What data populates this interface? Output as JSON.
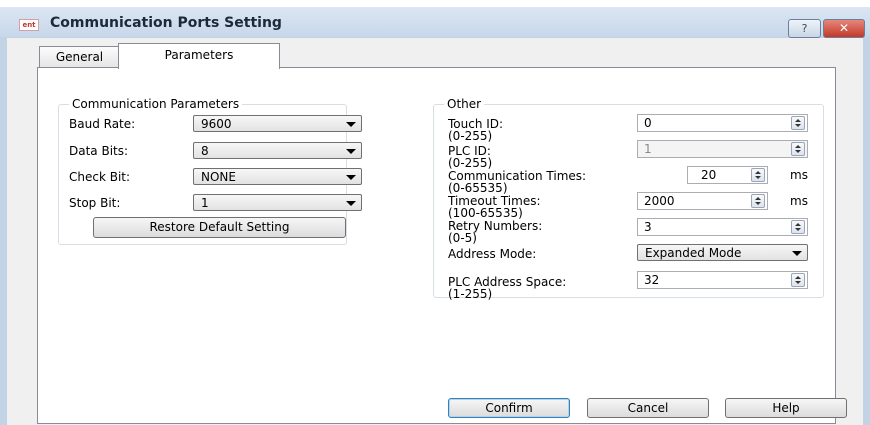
{
  "window": {
    "title": "Communication Ports Setting",
    "help_glyph": "?",
    "close_glyph": "✕",
    "app_icon_text": "ent"
  },
  "tabs": [
    {
      "label": "General"
    },
    {
      "label": "Parameters"
    }
  ],
  "comm_params": {
    "title": "Communication Parameters",
    "baud_rate": {
      "label": "Baud Rate:",
      "value": "9600"
    },
    "data_bits": {
      "label": "Data Bits:",
      "value": "8"
    },
    "check_bit": {
      "label": "Check Bit:",
      "value": "NONE"
    },
    "stop_bit": {
      "label": "Stop Bit:",
      "value": "1"
    },
    "restore_label": "Restore Default Setting"
  },
  "other": {
    "title": "Other",
    "touch_id": {
      "label": "Touch ID:",
      "range": "(0-255)",
      "value": "0"
    },
    "plc_id": {
      "label": "PLC ID:",
      "range": "(0-255)",
      "value": "1"
    },
    "comm_times": {
      "label": "Communication Times:",
      "range": "(0-65535)",
      "value": "20",
      "unit": "ms"
    },
    "timeout_times": {
      "label": "Timeout Times:",
      "range": "(100-65535)",
      "value": "2000",
      "unit": "ms"
    },
    "retry_numbers": {
      "label": "Retry Numbers:",
      "range": "(0-5)",
      "value": "3"
    },
    "address_mode": {
      "label": "Address Mode:",
      "value": "Expanded Mode"
    },
    "plc_address_space": {
      "label": "PLC Address Space:",
      "range": "(1-255)",
      "value": "32"
    }
  },
  "footer": {
    "confirm": "Confirm",
    "cancel": "Cancel",
    "help": "Help"
  }
}
